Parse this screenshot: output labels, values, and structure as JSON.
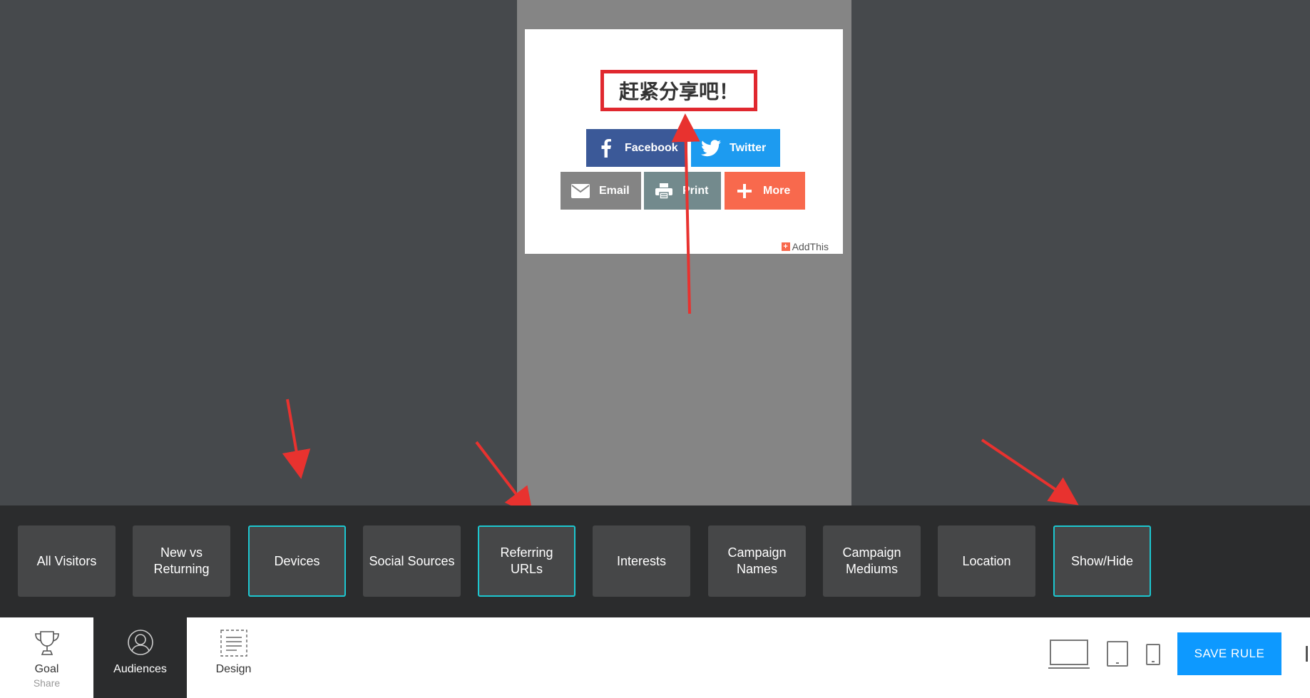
{
  "preview": {
    "headline": "赶紧分享吧！",
    "buttons": {
      "facebook": "Facebook",
      "twitter": "Twitter",
      "email": "Email",
      "print": "Print",
      "more": "More"
    },
    "branding": "AddThis",
    "colors": {
      "facebook": "#3b5998",
      "twitter": "#1d9bf0",
      "email": "#848484",
      "print": "#738a8d",
      "more": "#f8694d",
      "highlight": "#e0282f"
    }
  },
  "audiences": {
    "tiles": [
      {
        "label": "All Visitors",
        "active": false
      },
      {
        "label": "New vs\nReturning",
        "active": false
      },
      {
        "label": "Devices",
        "active": true
      },
      {
        "label": "Social Sources",
        "active": false
      },
      {
        "label": "Referring\nURLs",
        "active": true
      },
      {
        "label": "Interests",
        "active": false
      },
      {
        "label": "Campaign\nNames",
        "active": false
      },
      {
        "label": "Campaign\nMediums",
        "active": false
      },
      {
        "label": "Location",
        "active": false
      },
      {
        "label": "Show/Hide",
        "active": true
      }
    ],
    "active_border_color": "#1cc7d0"
  },
  "toolbar": {
    "goal": {
      "label": "Goal",
      "sub": "Share",
      "icon": "trophy-icon"
    },
    "audiences": {
      "label": "Audiences",
      "icon": "user-icon"
    },
    "design": {
      "label": "Design",
      "icon": "layout-icon"
    },
    "devices": [
      "desktop-icon",
      "tablet-icon",
      "mobile-icon"
    ],
    "save_label": "SAVE RULE",
    "save_color": "#0d99ff"
  }
}
